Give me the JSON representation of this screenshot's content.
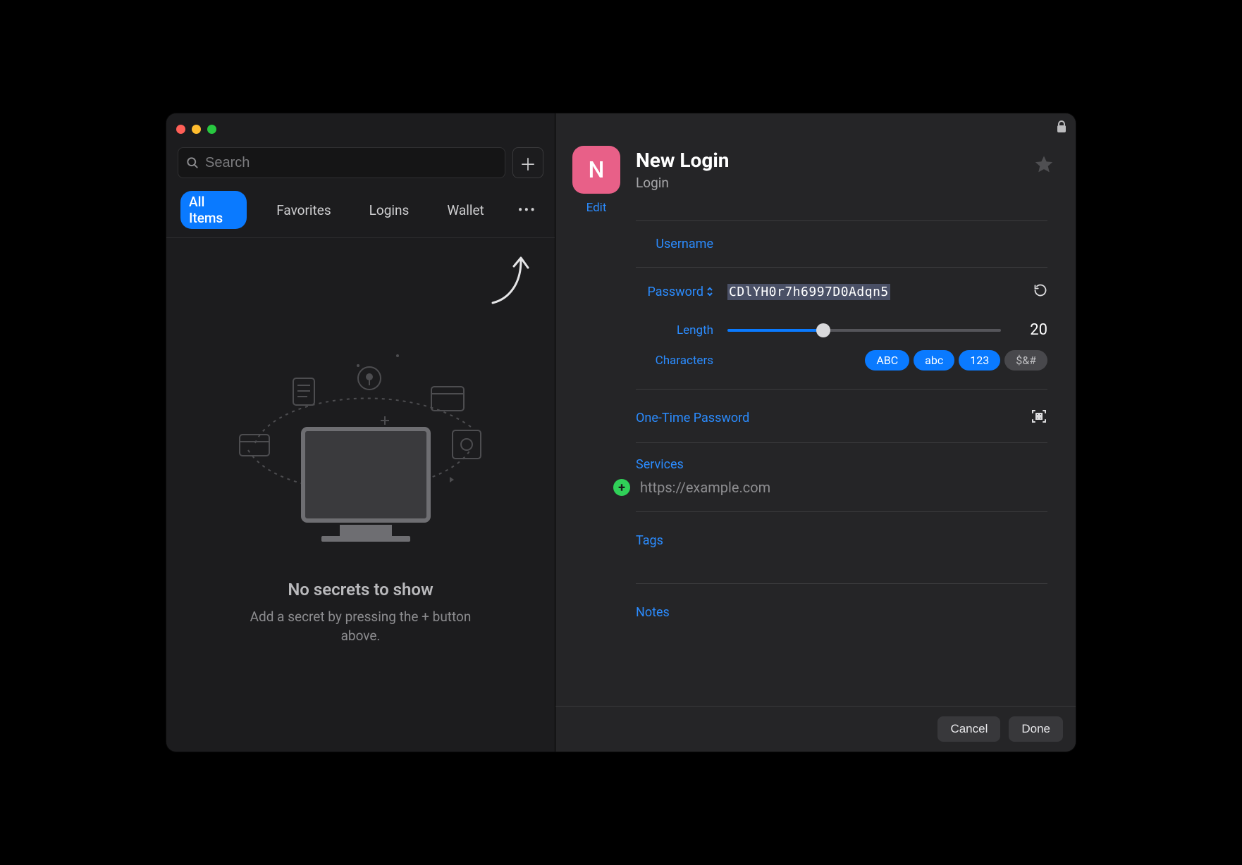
{
  "sidebar": {
    "search_placeholder": "Search",
    "add_glyph": "＋",
    "tabs": {
      "all": "All Items",
      "favorites": "Favorites",
      "logins": "Logins",
      "wallet": "Wallet",
      "more": "•••"
    },
    "empty": {
      "title": "No secrets to show",
      "subtitle": "Add a secret by pressing the + button above."
    }
  },
  "detail": {
    "avatar_letter": "N",
    "edit": "Edit",
    "title": "New Login",
    "subtitle": "Login",
    "username_label": "Username",
    "password_label": "Password",
    "password_value": "CDlYH0r7h6997D0Adqn5",
    "length_label": "Length",
    "length_value": "20",
    "characters_label": "Characters",
    "char_upper": "ABC",
    "char_lower": "abc",
    "char_digits": "123",
    "char_symbols": "$&#",
    "otp_label": "One-Time Password",
    "services_label": "Services",
    "service_placeholder": "https://example.com",
    "tags_label": "Tags",
    "notes_label": "Notes"
  },
  "footer": {
    "cancel": "Cancel",
    "done": "Done"
  }
}
